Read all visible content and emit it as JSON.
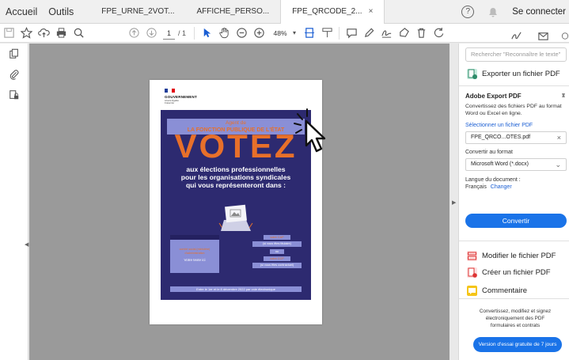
{
  "menubar": {
    "items": [
      "Accueil",
      "Outils"
    ],
    "tabs": [
      "FPE_URNE_2VOT...",
      "AFFICHE_PERSO...",
      "FPE_QRCODE_2..."
    ],
    "close_glyph": "×",
    "help_glyph": "?",
    "connect_label": "Se connecter"
  },
  "toolbar": {
    "page_current": "1",
    "page_total": "/ 1",
    "zoom": "48%",
    "caret": "▾"
  },
  "document": {
    "government": "GOUVERNEMENT",
    "motto": "Liberté Égalité Fraternité",
    "agent_line1": "Agent de",
    "agent_line2": "LA FONCTION PUBLIQUE DE L'ÉTAT",
    "votez": "VOTEZ",
    "elections_line1": "aux élections professionnelles",
    "elections_line2": "pour les organisations syndicales",
    "elections_line3": "qui vous représenteront dans :",
    "left_box_line1": "comité social (ministère)",
    "left_box_line2": "d'administration",
    "left_box_line3": "Votre texte ici",
    "right_box_1": "votre CAP",
    "right_box_2": "(si vous êtes titulaire)",
    "right_box_3": "ou",
    "right_box_4": "votre CCP",
    "right_box_5": "(si vous êtes contractuel)",
    "dates": "Entre le 1er et le 8 décembre 2022 par voie électronique"
  },
  "right_panel": {
    "search_placeholder": "Rechercher \"Reconnaître le texte\"",
    "export_row": "Exporter un fichier PDF",
    "export_title": "Adobe Export PDF",
    "export_desc": "Convertissez des fichiers PDF au format Word ou Excel en ligne.",
    "select_file": "Sélectionner un fichier PDF",
    "file_name": "FPE_QRCO...OTES.pdf",
    "file_clear": "×",
    "convert_to": "Convertir au format",
    "format": "Microsoft Word (*.docx)",
    "format_caret": "⌄",
    "language_label": "Langue du document :",
    "language": "Français",
    "change": "Changer",
    "convert_button": "Convertir",
    "modify": "Modifier le fichier PDF",
    "create": "Créer un fichier PDF",
    "create_caret": "⌄",
    "comment": "Commentaire",
    "footer_line1": "Convertissez, modifiez et signez électroniquement des PDF",
    "footer_line2": "formulaires et contrats",
    "trial_button": "Version d'essai gratuite de 7 jours"
  },
  "colors": {
    "accent": "#1a73e8",
    "poster_bg": "#2d2a70",
    "poster_orange": "#e8702a",
    "poster_lilac": "#8a8fd6"
  }
}
